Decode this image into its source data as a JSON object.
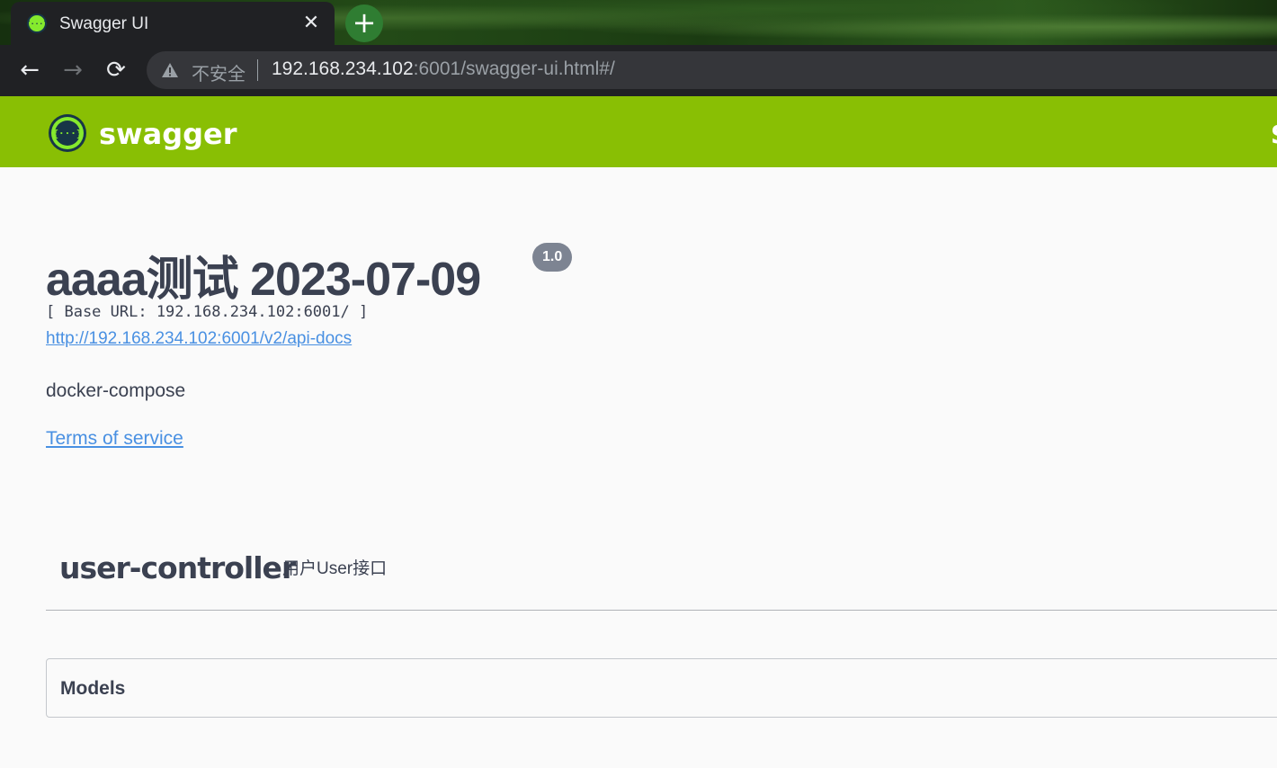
{
  "browser": {
    "tab": {
      "title": "Swagger UI",
      "close_glyph": "✕"
    },
    "new_tab_glyph": "+",
    "nav": {
      "back_glyph": "←",
      "forward_glyph": "→",
      "reload_glyph": "⟳"
    },
    "omnibox": {
      "security_label": "不安全",
      "url_host": "192.168.234.102",
      "url_rest": ":6001/swagger-ui.html#/"
    }
  },
  "swagger_bar": {
    "logo_text": "swagger",
    "logo_glyph": "{···}",
    "edge_text": "S",
    "color": "#89bf04"
  },
  "info": {
    "title": "aaaa测试 2023-07-09",
    "version": "1.0",
    "base_url": "[ Base URL: 192.168.234.102:6001/ ]",
    "api_docs_link": "http://192.168.234.102:6001/v2/api-docs",
    "description": "docker-compose",
    "terms_link": "Terms of service"
  },
  "tags": [
    {
      "name": "user-controller",
      "description": "用户User接口"
    }
  ],
  "models": {
    "title": "Models"
  },
  "colors": {
    "text": "#3b4151",
    "link": "#4990e2",
    "badge": "#7d8492"
  }
}
